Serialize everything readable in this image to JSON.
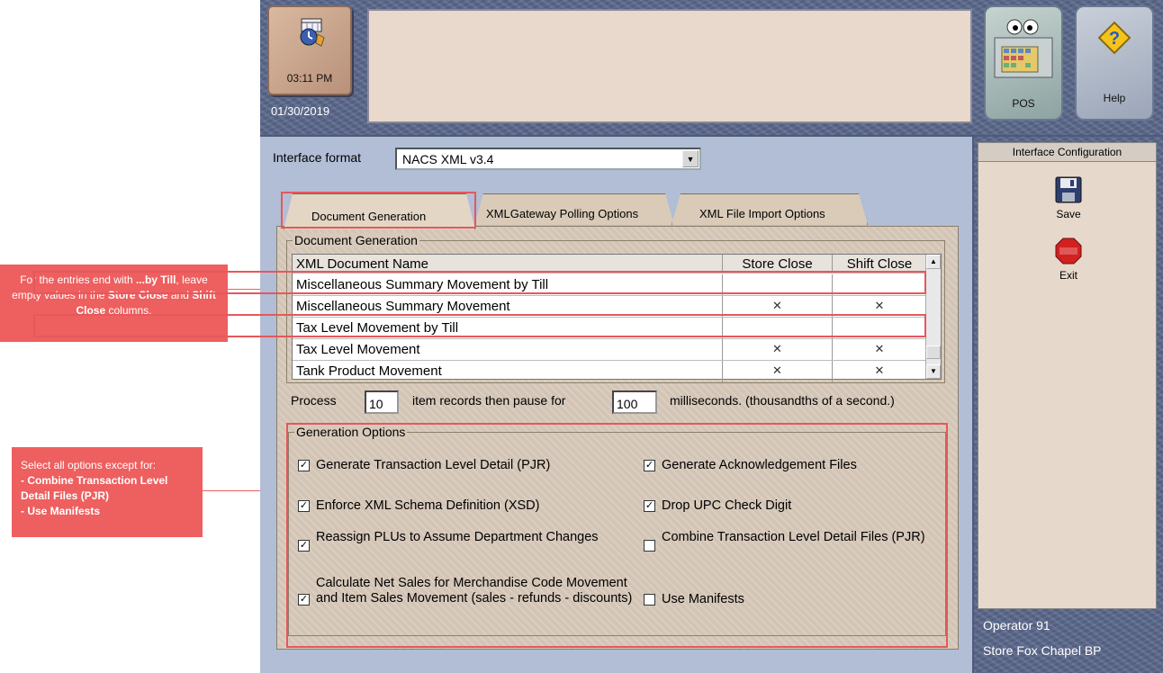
{
  "callouts": {
    "till_note": {
      "p1": "For the entries end with ",
      "b1": "...by Till",
      "p2": ", leave empty values in the ",
      "b2": "Store Close",
      "p3": " and ",
      "b3": "Shift Close",
      "p4": " columns."
    },
    "options_note": {
      "intro": "Select all options except for:",
      "item1": "- Combine Transaction Level Detail Files (PJR)",
      "item2": "- Use Manifests"
    }
  },
  "header": {
    "time": "03:11 PM",
    "date": "01/30/2019",
    "pos_label": "POS",
    "help_label": "Help"
  },
  "interface": {
    "format_label": "Interface format",
    "format_value": "NACS XML v3.4"
  },
  "tabs": [
    {
      "label": "Document Generation",
      "active": true
    },
    {
      "label": "XMLGateway Polling Options",
      "active": false
    },
    {
      "label": "XML File Import Options",
      "active": false
    }
  ],
  "doc_generation": {
    "legend": "Document Generation",
    "columns": [
      "XML Document Name",
      "Store Close",
      "Shift Close"
    ],
    "rows": [
      {
        "name": "Miscellaneous Summary Movement by Till",
        "store_close": "",
        "shift_close": ""
      },
      {
        "name": "Miscellaneous Summary Movement",
        "store_close": "X",
        "shift_close": "X"
      },
      {
        "name": "Tax Level Movement by Till",
        "store_close": "",
        "shift_close": ""
      },
      {
        "name": "Tax Level Movement",
        "store_close": "X",
        "shift_close": "X"
      },
      {
        "name": "Tank Product Movement",
        "store_close": "X",
        "shift_close": "X"
      }
    ]
  },
  "process": {
    "prefix": "Process",
    "records_value": "10",
    "middle": "item records then pause for",
    "pause_value": "100",
    "suffix": "milliseconds. (thousandths of a second.)"
  },
  "generation_options": {
    "legend": "Generation Options",
    "options": [
      {
        "label": "Generate Transaction Level Detail (PJR)",
        "checked": true
      },
      {
        "label": "Generate Acknowledgement Files",
        "checked": true
      },
      {
        "label": "Enforce XML Schema Definition (XSD)",
        "checked": true
      },
      {
        "label": "Drop UPC Check Digit",
        "checked": true
      },
      {
        "label": "Reassign PLUs to Assume Department Changes",
        "checked": true
      },
      {
        "label": "Combine Transaction Level Detail Files (PJR)",
        "checked": false
      },
      {
        "label": "Calculate Net Sales for Merchandise Code Movement and Item Sales Movement  (sales - refunds - discounts)",
        "checked": true
      },
      {
        "label": "Use Manifests",
        "checked": false
      }
    ]
  },
  "sidebar": {
    "title": "Interface Configuration",
    "save_label": "Save",
    "exit_label": "Exit",
    "exit_icon_text": "CANCEL",
    "operator": "Operator 91",
    "store": "Store Fox Chapel BP"
  },
  "colors": {
    "callout": "#ee5f5f",
    "highlight": "#e5585b",
    "app_bg": "#5d6a8e",
    "panel_bg": "#d8cabb"
  }
}
